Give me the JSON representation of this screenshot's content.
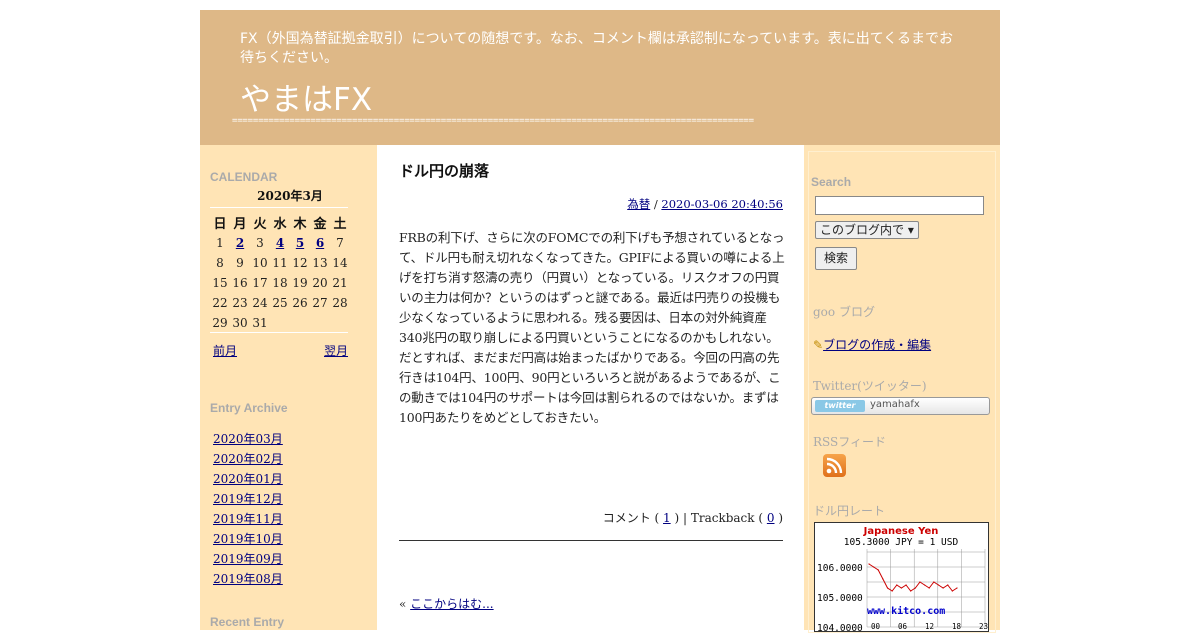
{
  "header": {
    "description": "FX（外国為替証拠金取引）についての随想です。なお、コメント欄は承認制になっています。表に出てくるまでお待ちください。",
    "title": "やまはFX",
    "separator": "===================================================================================================="
  },
  "calendar": {
    "heading": "CALENDAR",
    "month": "2020年3月",
    "weekdays": [
      "日",
      "月",
      "火",
      "水",
      "木",
      "金",
      "土"
    ],
    "weeks": [
      [
        "1",
        "2",
        "3",
        "4",
        "5",
        "6",
        "7"
      ],
      [
        "8",
        "9",
        "10",
        "11",
        "12",
        "13",
        "14"
      ],
      [
        "15",
        "16",
        "17",
        "18",
        "19",
        "20",
        "21"
      ],
      [
        "22",
        "23",
        "24",
        "25",
        "26",
        "27",
        "28"
      ],
      [
        "29",
        "30",
        "31",
        "",
        "",
        "",
        ""
      ]
    ],
    "linked_days": [
      "2",
      "4",
      "5",
      "6"
    ],
    "prev_label": "前月",
    "next_label": "翌月"
  },
  "archive": {
    "heading": "Entry Archive",
    "items": [
      "2020年03月",
      "2020年02月",
      "2020年01月",
      "2019年12月",
      "2019年11月",
      "2019年10月",
      "2019年09月",
      "2019年08月"
    ]
  },
  "recent": {
    "heading": "Recent Entry"
  },
  "post": {
    "title": "ドル円の崩落",
    "category": "為替",
    "separator": " / ",
    "datetime": "2020-03-06 20:40:56",
    "body": "FRBの利下げ、さらに次のFOMCでの利下げも予想されているとなって、ドル円も耐え切れなくなってきた。GPIFによる買いの噂による上げを打ち消す怒濤の売り（円買い）となっている。リスクオフの円買いの主力は何か？というのはずっと謎である。最近は円売りの投機も少なくなっているように思われる。残る要因は、日本の対外純資産340兆円の取り崩しによる円買いということになるのかもしれない。だとすれば、まだまだ円高は始まったばかりである。今回の円高の先行きは104円、100円、90円といろいろと説があるようであるが、この動きでは104円のサポートは今回は割られるのではないか。まずは100円あたりをめどとしておきたい。",
    "comment_label": "コメント ( ",
    "comment_count": "1",
    "trackback_label": " ) | Trackback ( ",
    "trackback_count": "0",
    "close_paren": " )",
    "prev_prefix": "« ",
    "prev_link": "ここからはむ..."
  },
  "sidebar_right": {
    "search_heading": "Search",
    "search_value": "",
    "search_scope": "このブログ内で",
    "search_button": "検索",
    "goo_heading": "goo ブログ",
    "goo_link": "ブログの作成・編集",
    "twitter_heading": "Twitter(ツイッター)",
    "twitter_logo": "twitter",
    "twitter_user": "yamahafx",
    "rss_heading": "RSSフィード",
    "rate_heading": "ドル円レート"
  },
  "chart_data": {
    "type": "line",
    "title": "Japanese Yen",
    "subtitle": "105.3000 JPY = 1 USD",
    "watermark": "www.kitco.com",
    "y_ticks": [
      "106.0000",
      "105.0000",
      "104.0000"
    ],
    "x_ticks": [
      "00",
      "06",
      "12",
      "18",
      "23"
    ],
    "ylim": [
      104.0,
      106.6
    ],
    "x": [
      0,
      1,
      2,
      3,
      4,
      5,
      6,
      7,
      8,
      9,
      10,
      11,
      12,
      13,
      14,
      15,
      16,
      17,
      18,
      19
    ],
    "values": [
      106.1,
      106.0,
      105.9,
      105.6,
      105.3,
      105.2,
      105.4,
      105.3,
      105.4,
      105.2,
      105.3,
      105.5,
      105.4,
      105.3,
      105.5,
      105.4,
      105.3,
      105.4,
      105.2,
      105.3
    ],
    "colors": {
      "title": "#cc0000",
      "line": "#cc0000",
      "watermark": "#0000cc"
    }
  }
}
